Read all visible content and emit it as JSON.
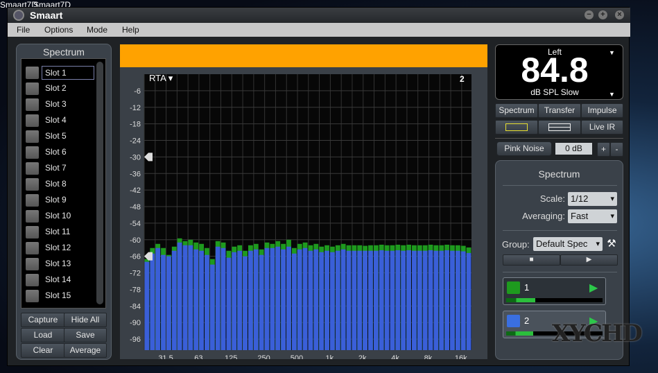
{
  "desktop": {
    "labels": [
      "Smaart7D",
      "Smaart7D"
    ]
  },
  "window": {
    "title": "Smaart",
    "controls": [
      "minimize",
      "maximize",
      "close"
    ]
  },
  "menu": [
    "File",
    "Options",
    "Mode",
    "Help"
  ],
  "left_panel": {
    "title": "Spectrum",
    "slots": [
      "Slot 1",
      "Slot 2",
      "Slot 3",
      "Slot 4",
      "Slot 5",
      "Slot 6",
      "Slot 7",
      "Slot 8",
      "Slot 9",
      "Slot 10",
      "Slot 11",
      "Slot 12",
      "Slot 13",
      "Slot 14",
      "Slot 15"
    ],
    "buttons": [
      "Capture",
      "Hide All",
      "Load",
      "Save",
      "Clear",
      "Average"
    ]
  },
  "graph": {
    "mode_label": "RTA ▾",
    "trace_count": "2",
    "header_color": "#ffa200"
  },
  "meter": {
    "channel": "Left",
    "value": "84.8",
    "unit": "dB SPL Slow"
  },
  "mode_tabs": [
    "Spectrum",
    "Transfer",
    "Impulse"
  ],
  "layout_tabs": {
    "live_ir": "Live IR"
  },
  "generator": {
    "label": "Pink Noise",
    "level": "0 dB",
    "plus": "+",
    "minus": "-"
  },
  "spectrum_panel": {
    "title": "Spectrum",
    "scale_label": "Scale:",
    "scale_value": "1/12",
    "averaging_label": "Averaging:",
    "averaging_value": "Fast",
    "group_label": "Group:",
    "group_value": "Default Spec"
  },
  "traces": [
    {
      "name": "1",
      "color": "#1e9a1e",
      "level": 0.3
    },
    {
      "name": "2",
      "color": "#3a6fe0",
      "level": 0.28
    }
  ],
  "watermark": "XYCHD",
  "chart_data": {
    "type": "bar",
    "xscale": "log",
    "xlim": [
      20,
      20000
    ],
    "ylim": [
      -100,
      0
    ],
    "grid": true,
    "yticks": [
      -6,
      -12,
      -18,
      -24,
      -30,
      -36,
      -42,
      -48,
      -54,
      -60,
      -66,
      -72,
      -78,
      -84,
      -90,
      -96
    ],
    "xticks": [
      "31.5",
      "63",
      "125",
      "250",
      "500",
      "1k",
      "2k",
      "4k",
      "8k",
      "16k"
    ],
    "xtick_values": [
      31.5,
      63,
      125,
      250,
      500,
      1000,
      2000,
      4000,
      8000,
      16000
    ],
    "markers": [
      -30,
      -66
    ],
    "series": [
      {
        "color": "#1e9a1e",
        "values": [
          -67,
          -63,
          -61.5,
          -63,
          -65.5,
          -62.5,
          -59.5,
          -60.5,
          -60,
          -61,
          -61.5,
          -63,
          -67,
          -60.5,
          -61,
          -64,
          -62.5,
          -62,
          -64,
          -62,
          -61.5,
          -63.5,
          -61,
          -61.5,
          -60.5,
          -61.5,
          -60,
          -63,
          -61.5,
          -61,
          -62,
          -61.5,
          -62.5,
          -62,
          -62.5,
          -62,
          -61.5,
          -62,
          -62,
          -62,
          -62.2,
          -62,
          -62,
          -61.8,
          -62,
          -62,
          -61.8,
          -62,
          -61.8,
          -62,
          -62,
          -62,
          -61.8,
          -62,
          -62,
          -61.8,
          -62,
          -62,
          -62.2,
          -62.8
        ]
      },
      {
        "color": "#3a5fd8",
        "values": [
          -68,
          -65,
          -63,
          -65.5,
          -66,
          -64,
          -61,
          -62,
          -62,
          -63.5,
          -64,
          -65.5,
          -69,
          -62.5,
          -63,
          -66.5,
          -64.5,
          -64,
          -66,
          -64,
          -63.5,
          -65.5,
          -63,
          -63,
          -62.5,
          -63.5,
          -62.5,
          -65,
          -63.5,
          -63,
          -64,
          -63.5,
          -64.5,
          -64,
          -64.5,
          -64,
          -63.5,
          -64,
          -64,
          -64,
          -64,
          -64,
          -64,
          -63.8,
          -64,
          -64,
          -63.8,
          -64,
          -63.8,
          -64,
          -64,
          -64,
          -63.8,
          -64,
          -64,
          -63.8,
          -64,
          -64,
          -64.2,
          -64.8
        ]
      }
    ]
  }
}
